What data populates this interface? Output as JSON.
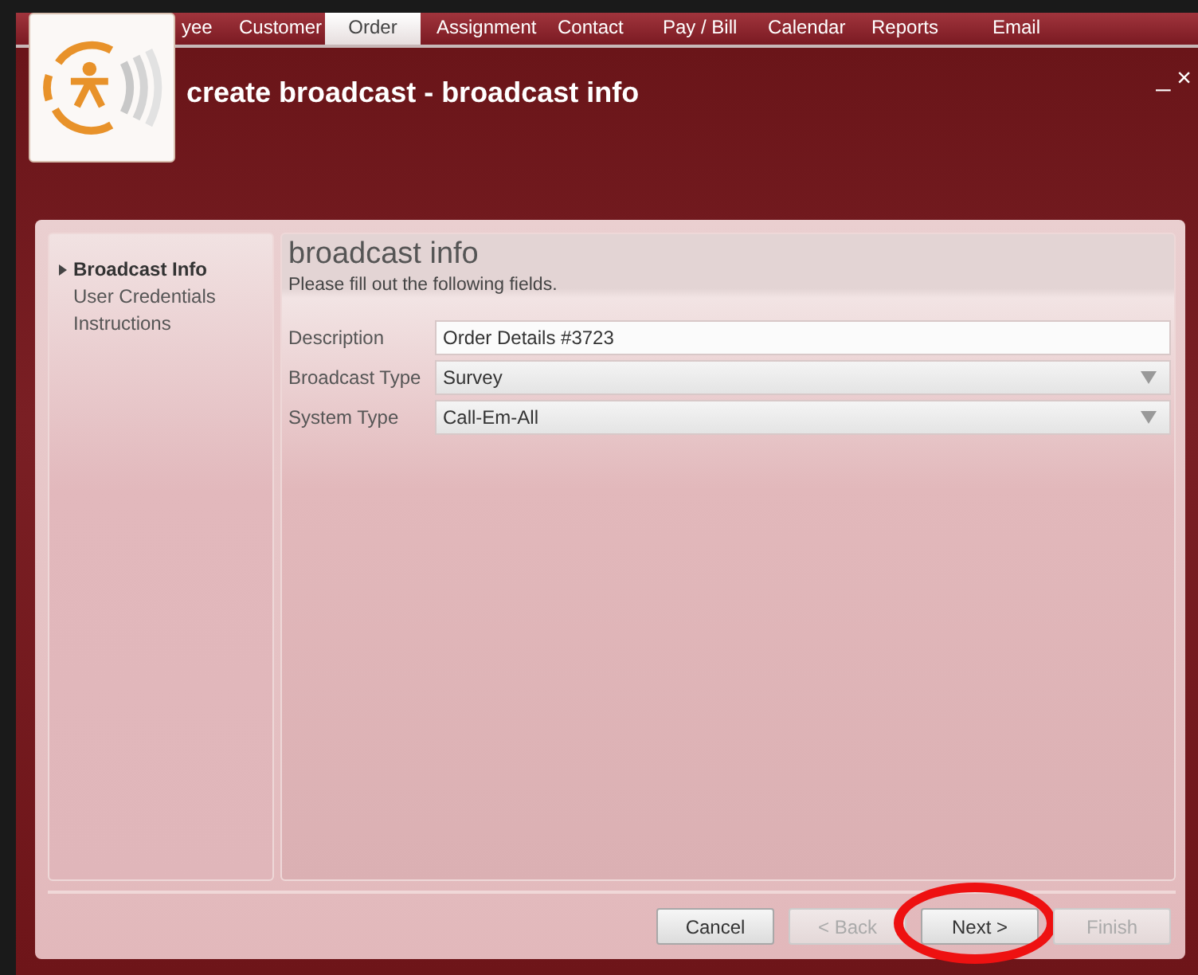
{
  "nav_tabs": [
    {
      "label": "yee",
      "selected": false
    },
    {
      "label": "Customer",
      "selected": false
    },
    {
      "label": "Order",
      "selected": true
    },
    {
      "label": "Assignment",
      "selected": false
    },
    {
      "label": "Contact",
      "selected": false
    },
    {
      "label": "Pay / Bill",
      "selected": false
    },
    {
      "label": "Calendar",
      "selected": false
    },
    {
      "label": "Reports",
      "selected": false
    },
    {
      "label": "Email",
      "selected": false
    }
  ],
  "window": {
    "title": "create broadcast - broadcast info",
    "minimize": "_",
    "close": "×"
  },
  "steps": [
    {
      "label": "Broadcast Info",
      "selected": true
    },
    {
      "label": "User Credentials",
      "selected": false
    },
    {
      "label": "Instructions",
      "selected": false
    }
  ],
  "content": {
    "heading": "broadcast info",
    "subtitle": "Please fill out the following fields.",
    "fields": [
      {
        "label": "Description",
        "kind": "text",
        "value": "Order Details #3723"
      },
      {
        "label": "Broadcast Type",
        "kind": "dropdown",
        "value": "Survey"
      },
      {
        "label": "System Type",
        "kind": "dropdown",
        "value": "Call-Em-All"
      }
    ]
  },
  "buttons": [
    {
      "label": "Cancel",
      "disabled": false,
      "highlighted": false
    },
    {
      "label": "< Back",
      "disabled": true,
      "highlighted": false
    },
    {
      "label": "Next >",
      "disabled": false,
      "highlighted": true
    },
    {
      "label": "Finish",
      "disabled": true,
      "highlighted": false
    }
  ]
}
